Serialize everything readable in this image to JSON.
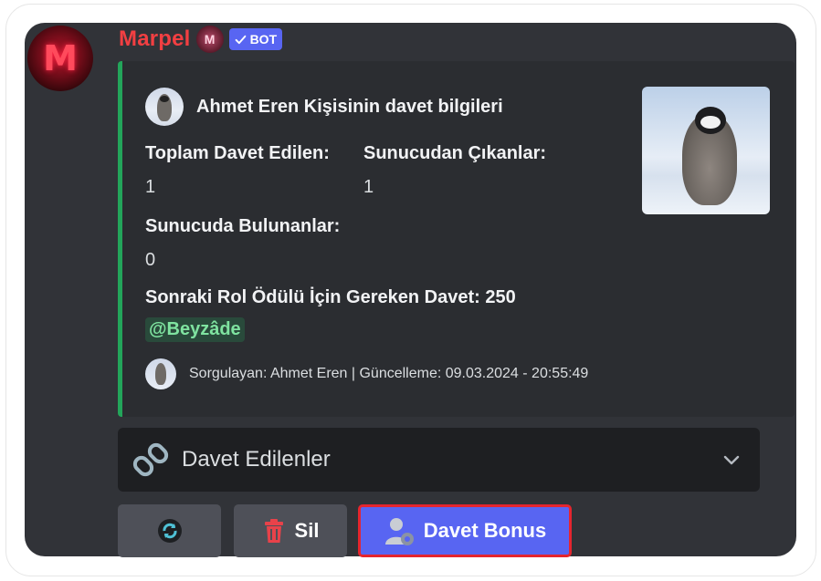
{
  "message": {
    "author_name": "Marpel",
    "avatar_letter": "M",
    "mini_badge_letter": "M",
    "bot_tag": "BOT",
    "username_color": "#f23f42"
  },
  "embed": {
    "accent_color": "#23a55a",
    "author": "Ahmet Eren Kişisinin davet bilgileri",
    "fields": [
      {
        "name": "Toplam Davet Edilen:",
        "value": "1"
      },
      {
        "name": "Sunucudan Çıkanlar:",
        "value": "1"
      },
      {
        "name": "Sunucuda Bulunanlar:",
        "value": "0"
      }
    ],
    "reward_label": "Sonraki Rol Ödülü İçin Gereken Davet:",
    "reward_count": "250",
    "reward_role": "@Beyzâde",
    "footer": "Sorgulayan: Ahmet Eren | Güncelleme: 09.03.2024 - 20:55:49"
  },
  "select_menu": {
    "icon": "link-icon",
    "label": "Davet Edilenler"
  },
  "buttons": {
    "refresh_icon": "refresh-icon",
    "delete_icon": "trash-icon",
    "delete_label": "Sil",
    "bonus_icon": "user-gear-icon",
    "bonus_label": "Davet Bonus"
  }
}
